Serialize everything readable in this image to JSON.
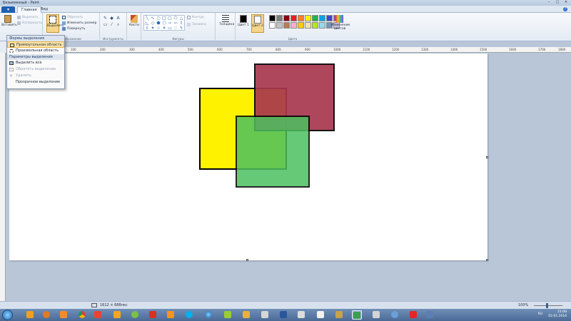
{
  "window": {
    "title": "Безымянный - Paint",
    "controls": [
      "–",
      "□",
      "✕"
    ]
  },
  "tabs": [
    {
      "label": "Главная",
      "selected": true
    },
    {
      "label": "Вид",
      "selected": false
    }
  ],
  "ribbon": {
    "clipboard": {
      "group_label": "Буфер обмена",
      "paste_label": "Вставить",
      "cut_label": "Вырезать",
      "copy_label": "Копировать"
    },
    "image": {
      "group_label": "Изображение",
      "select_label": "Выделить",
      "crop_label": "Обрезать",
      "resize_label": "Изменить размер",
      "rotate_label": "Повернуть"
    },
    "tools": {
      "group_label": "Инструменты"
    },
    "brushes_label": "Кисти",
    "shapes": {
      "group_label": "Фигуры",
      "outline_label": "Контур",
      "fill_label": "Заливка"
    },
    "thickness_label": "Толщина",
    "colors": {
      "group_label": "Цвета",
      "color1_label": "Цвет 1",
      "color2_label": "Цвет 2",
      "edit_colors_label": "Изменение цветов",
      "palette": [
        "#000000",
        "#7f7f7f",
        "#880015",
        "#ed1c24",
        "#ff7f27",
        "#fff200",
        "#22b14c",
        "#00a2e8",
        "#3f48cc",
        "#a349a4",
        "#ffffff",
        "#c3c3c3",
        "#b97a57",
        "#ffaec9",
        "#ffc90e",
        "#efe4b0",
        "#b5e61d",
        "#99d9ea",
        "#7092be",
        "#c8bfe7"
      ]
    }
  },
  "select_menu": {
    "shapes_header": "Формы выделения",
    "rect_label": "Прямоугольная область",
    "freeform_label": "Произвольная область",
    "options_header": "Параметры выделения",
    "select_all_label": "Выделить все",
    "invert_label": "Обратить выделение",
    "delete_label": "Удалить",
    "transparent_label": "Прозрачное выделение"
  },
  "ruler": {
    "ticks": [
      "100",
      "200",
      "300",
      "400",
      "500",
      "600",
      "700",
      "800",
      "900",
      "1000",
      "1100",
      "1200",
      "1300",
      "1400",
      "1500",
      "1600",
      "1700",
      "1800"
    ]
  },
  "canvas": {
    "shapes": [
      {
        "name": "yellow-square",
        "color": "#fff200"
      },
      {
        "name": "red-square",
        "color": "#a8384f"
      },
      {
        "name": "green-square",
        "color": "#4cc060"
      }
    ]
  },
  "statusbar": {
    "image_size": "1612 × 688пкс",
    "zoom": "100%"
  },
  "taskbar": {
    "language": "RU",
    "time": "21:08",
    "date": "02.01.2016"
  }
}
